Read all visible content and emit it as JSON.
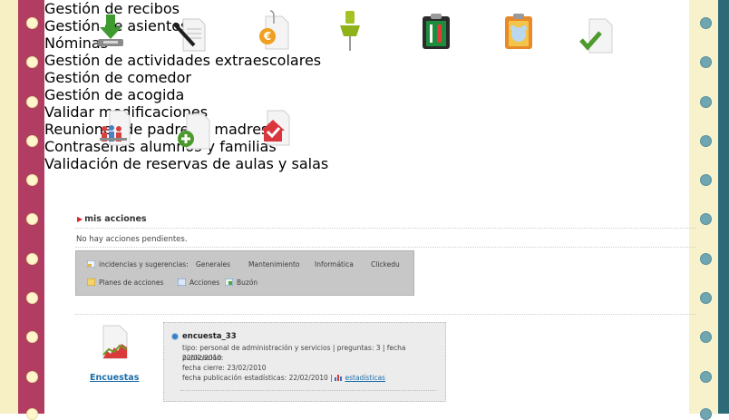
{
  "tiles_row1": [
    {
      "label": "Gestión de recibos",
      "icon": "download-tray-icon"
    },
    {
      "label": "Gestión de asientos",
      "icon": "pen-document-icon"
    },
    {
      "label": "Nóminas",
      "icon": "euro-document-icon"
    },
    {
      "label": "Gestión de actividades extraescolares",
      "icon": "pushpin-icon"
    },
    {
      "label": "Gestión de comedor",
      "icon": "cutlery-clipboard-icon"
    },
    {
      "label": "Gestión de acogida",
      "icon": "bear-clipboard-icon"
    },
    {
      "label": "Validar modificaciones",
      "icon": "checkmark-document-icon"
    }
  ],
  "tiles_row2": [
    {
      "label": "Reuniones de padres y madres",
      "icon": "people-meeting-icon"
    },
    {
      "label": "Contraseñas alumnos y familias",
      "icon": "plus-document-icon"
    },
    {
      "label": "Validación de reservas de aulas y salas",
      "icon": "house-check-icon"
    }
  ],
  "mis_acciones": {
    "title": "mis acciones",
    "empty_text": "No hay acciones pendientes."
  },
  "toolbar": {
    "incidencias_label": "incidencias y sugerencias:",
    "generales": "Generales",
    "mantenimiento": "Mantenimiento",
    "informatica": "Informática",
    "clickedu": "Clickedu",
    "planes": "Planes de acciones",
    "acciones": "Acciones",
    "buzon": "Buzón"
  },
  "encuestas": {
    "label": "Encuestas",
    "item_title": "encuesta_33",
    "line1": "tipo: personal de administración y servicios | preguntas: 3 | fecha publicación:",
    "line2": "22/02/2010",
    "line3": "fecha cierre: 23/02/2010",
    "line4_prefix": "fecha publicación estadísticas: 22/02/2010 |",
    "stats_link": "estadísticas"
  },
  "colors": {
    "link": "#1b6ea8",
    "binder_pink": "#b23d62",
    "binder_teal": "#2c6a77"
  }
}
